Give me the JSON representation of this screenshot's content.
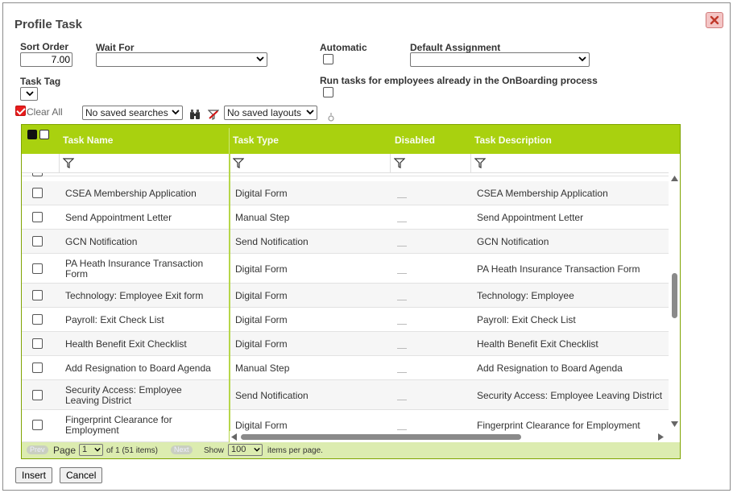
{
  "dialog": {
    "title": "Profile Task"
  },
  "form": {
    "sort_order_label": "Sort Order",
    "sort_order_value": "7.00",
    "wait_for_label": "Wait For",
    "wait_for_value": "",
    "automatic_label": "Automatic",
    "default_assignment_label": "Default Assignment",
    "default_assignment_value": "",
    "task_tag_label": "Task Tag",
    "task_tag_value": "",
    "run_tasks_label": "Run tasks for employees already in the OnBoarding process"
  },
  "toolbar": {
    "clear_all_label": "Clear All",
    "saved_searches_value": "No saved searches",
    "saved_layouts_value": "No saved layouts"
  },
  "grid": {
    "columns": [
      "Task Name",
      "Task Type",
      "Disabled",
      "Task Description"
    ],
    "rows": [
      {
        "name": "CSEA Membership Application",
        "type": "Digital Form",
        "description": "CSEA Membership Application"
      },
      {
        "name": "Send Appointment Letter",
        "type": "Manual Step",
        "description": "Send Appointment Letter"
      },
      {
        "name": "GCN Notification",
        "type": "Send Notification",
        "description": "GCN Notification"
      },
      {
        "name": "PA Heath Insurance Transaction Form",
        "type": "Digital Form",
        "description": "PA Heath Insurance Transaction Form"
      },
      {
        "name": "Technology: Employee Exit form",
        "type": "Digital Form",
        "description": "Technology: Employee"
      },
      {
        "name": "Payroll: Exit Check List",
        "type": "Digital Form",
        "description": "Payroll: Exit Check List"
      },
      {
        "name": "Health Benefit Exit Checklist",
        "type": "Digital Form",
        "description": "Health Benefit Exit Checklist"
      },
      {
        "name": "Add Resignation to Board Agenda",
        "type": "Manual Step",
        "description": "Add Resignation to Board Agenda"
      },
      {
        "name": "Security Access: Employee Leaving District",
        "type": "Send Notification",
        "description": "Security Access: Employee Leaving District"
      },
      {
        "name": "Fingerprint Clearance for Employment",
        "type": "Digital Form",
        "description": "Fingerprint Clearance for Employment"
      }
    ]
  },
  "pager": {
    "prev_label": "Prev",
    "page_label": "Page",
    "page_value": "1",
    "of_text": "of 1 (51 items)",
    "next_label": "Next",
    "show_label": "Show",
    "per_page_value": "100",
    "items_per_page_label": "items per page."
  },
  "footer": {
    "insert_label": "Insert",
    "cancel_label": "Cancel"
  }
}
